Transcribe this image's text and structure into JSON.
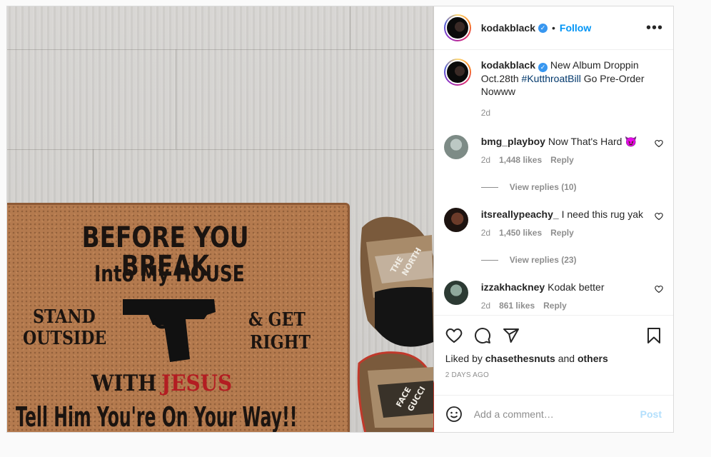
{
  "header": {
    "username": "kodakblack",
    "verified_icon": "verified-badge-icon",
    "separator": "•",
    "follow_label": "Follow",
    "more_icon": "more-options-icon"
  },
  "caption": {
    "username": "kodakblack",
    "text_before": "New Album Droppin Oct.28th",
    "hashtag": "#KutthroatBill",
    "text_after": "Go Pre-Order Nowww",
    "time": "2d"
  },
  "mat": {
    "line1": "BEFORE YOU BREAK",
    "line2": "Into My HOUSE",
    "left1": "STAND",
    "left2": "OUTSIDE",
    "right1": "& GET",
    "right2": "RIGHT",
    "with": "WITH",
    "jesus": "JESUS",
    "line_bottom": "Tell Him You're On Your Way!!"
  },
  "slide_text": {
    "line1": "THE",
    "line2": "NORTH",
    "line3": "FACE",
    "line4": "GUCCI"
  },
  "comments": [
    {
      "username": "bmg_playboy",
      "text": "Now That's Hard 😈",
      "time": "2d",
      "likes": "1,448 likes",
      "reply": "Reply",
      "view_replies": "View replies (10)"
    },
    {
      "username": "itsreallypeachy_",
      "text": "I need this rug yak",
      "time": "2d",
      "likes": "1,450 likes",
      "reply": "Reply",
      "view_replies": "View replies (23)"
    },
    {
      "username": "izzakhackney",
      "text": "Kodak better",
      "time": "2d",
      "likes": "861 likes",
      "reply": "Reply"
    }
  ],
  "actions": {
    "liked_prefix": "Liked by",
    "liked_user": "chasethesnuts",
    "liked_and": "and",
    "liked_others": "others",
    "time_ago": "2 DAYS AGO"
  },
  "add_comment": {
    "placeholder": "Add a comment…",
    "post_label": "Post"
  },
  "colors": {
    "accent": "#0095f6",
    "hashtag": "#00376b",
    "muted": "#8e8e8e",
    "post_disabled": "#b2dffc"
  }
}
